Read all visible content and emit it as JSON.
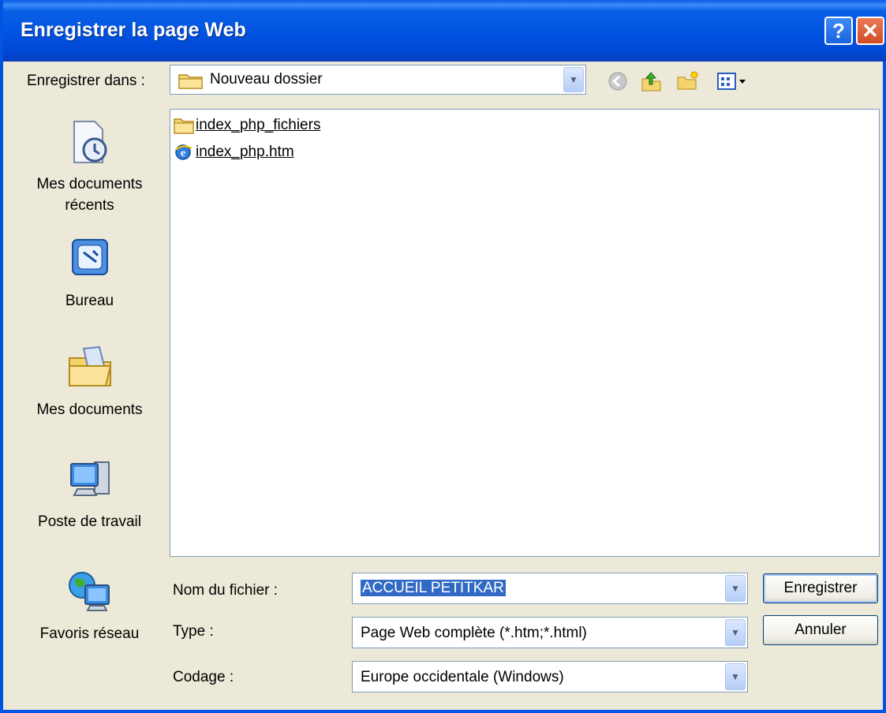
{
  "window": {
    "title": "Enregistrer la page Web",
    "help_label": "?",
    "close_label": "✕"
  },
  "save_in": {
    "label": "Enregistrer dans :",
    "value": "Nouveau dossier"
  },
  "toolbar": {
    "icons": [
      "back-icon",
      "up-folder-icon",
      "new-folder-icon",
      "view-menu-icon"
    ]
  },
  "places": [
    {
      "label_line1": "Mes documents",
      "label_line2": "récents",
      "icon": "recent-documents-icon"
    },
    {
      "label_line1": "Bureau",
      "label_line2": "",
      "icon": "desktop-icon"
    },
    {
      "label_line1": "Mes documents",
      "label_line2": "",
      "icon": "my-documents-icon"
    },
    {
      "label_line1": "Poste de travail",
      "label_line2": "",
      "icon": "my-computer-icon"
    },
    {
      "label_line1": "Favoris réseau",
      "label_line2": "",
      "icon": "network-places-icon"
    }
  ],
  "files": [
    {
      "name": "index_php_fichiers",
      "icon": "folder-icon"
    },
    {
      "name": "index_php.htm",
      "icon": "html-file-icon"
    }
  ],
  "filename": {
    "label": "Nom du fichier :",
    "value": "ACCUEIL PETITKAR"
  },
  "type": {
    "label": "Type :",
    "value": "Page Web complète (*.htm;*.html)"
  },
  "encoding": {
    "label": "Codage :",
    "value": "Europe occidentale (Windows)"
  },
  "buttons": {
    "save": "Enregistrer",
    "cancel": "Annuler"
  },
  "colors": {
    "title_bar": "#0054e3",
    "dialog_bg": "#ece9d8",
    "selection": "#316ac5"
  }
}
